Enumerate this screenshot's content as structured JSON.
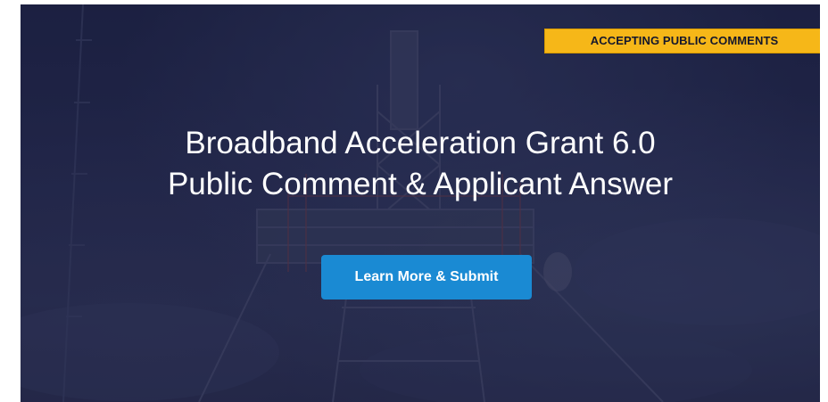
{
  "banner": {
    "badge_label": "ACCEPTING PUBLIC COMMENTS",
    "title_line1": "Broadband Acceleration Grant 6.0",
    "title_line2": "Public Comment & Applicant Answer",
    "cta_label": "Learn More & Submit",
    "background_image": "cell-tower-photo",
    "colors": {
      "overlay": "#1f2446",
      "badge": "#f6b718",
      "badge_text": "#14172c",
      "button": "#1a8ad3",
      "title_text": "#ffffff"
    }
  }
}
